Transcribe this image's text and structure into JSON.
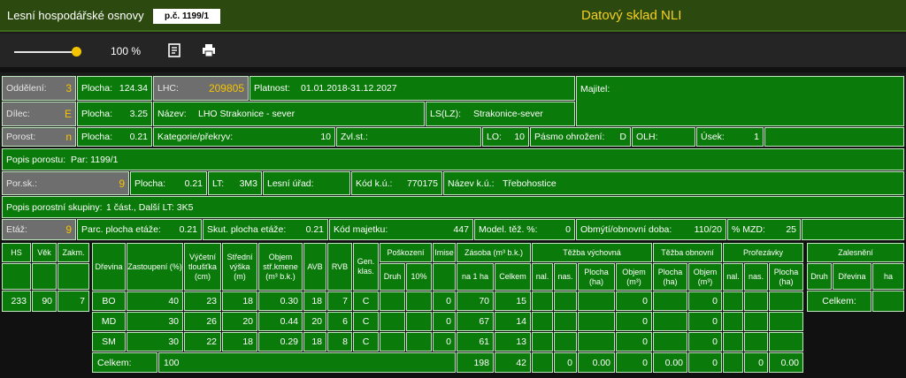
{
  "header": {
    "title": "Lesní hospodářské osnovy",
    "pc": "p.č. 1199/1",
    "datasklad": "Datový sklad NLI"
  },
  "toolbar": {
    "zoom": "100 %",
    "zoom_level": 0.9,
    "icons": [
      "notes-icon",
      "print-icon"
    ]
  },
  "row1": {
    "oddeleni_label": "Oddělení:",
    "oddeleni": "3",
    "plocha_label": "Plocha:",
    "plocha": "124.34",
    "lhc_label": "LHC:",
    "lhc": "209805",
    "platnost_label": "Platnost:",
    "platnost": "01.01.2018-31.12.2027",
    "majitel_label": "Majitel:"
  },
  "row2": {
    "dilec_label": "Dílec:",
    "dilec": "E",
    "plocha_label": "Plocha:",
    "plocha": "3.25",
    "nazev_label": "Název:",
    "nazev": "LHO Strakonice - sever",
    "ls_label": "LS(LZ):",
    "ls": "Strakonice-sever"
  },
  "row3": {
    "porost_label": "Porost:",
    "porost": "n",
    "plocha_label": "Plocha:",
    "plocha": "0.21",
    "kat_label": "Kategorie/překryv:",
    "kat": "10",
    "zvl_label": "Zvl.st.:",
    "lo_label": "LO:",
    "lo": "10",
    "pasmo_label": "Pásmo ohrožení:",
    "pasmo": "D",
    "olh_label": "OLH:",
    "usek_label": "Úsek:",
    "usek": "1"
  },
  "row4": {
    "popis_label": "Popis porostu:",
    "popis": "Par: 1199/1"
  },
  "row5": {
    "porsk_label": "Por.sk.:",
    "porsk": "9",
    "plocha_label": "Plocha:",
    "plocha": "0.21",
    "lt_label": "LT:",
    "lt": "3M3",
    "urad_label": "Lesní úřad:",
    "kodku_label": "Kód k.ú.:",
    "kodku": "770175",
    "nazevku_label": "Název k.ú.:",
    "nazevku": "Třebohostice"
  },
  "row6": {
    "popis_label": "Popis porostní skupiny:",
    "popis": "1 část., Další LT: 3K5"
  },
  "row7": {
    "etaz_label": "Etáž:",
    "etaz": "9",
    "parc_label": "Parc. plocha etáže:",
    "parc": "0.21",
    "skut_label": "Skut. plocha etáže:",
    "skut": "0.21",
    "kodmaj_label": "Kód majetku:",
    "kodmaj": "447",
    "model_label": "Model. těž. %:",
    "model": "0",
    "obmyti_label": "Obmýtí/obnovní doba:",
    "obmyti": "110/20",
    "mzd_label": "% MZD:",
    "mzd": "25"
  },
  "hs": {
    "headers": [
      "HS",
      "Věk",
      "Zakm."
    ],
    "values": [
      "233",
      "90",
      "7"
    ]
  },
  "species": {
    "headers": {
      "drevina": "Dřevina",
      "zastoupeni": "Zastoupení (%)",
      "vycetni": "Výčetní tloušťka (cm)",
      "stredni": "Střední výška (m)",
      "objem": "Objem stř.kmene (m³ b.k.)",
      "avb": "AVB",
      "rvb": "RVB",
      "gen": "Gen. klas.",
      "poskozeni": "Poškození",
      "druh": "Druh",
      "pct10": "10%",
      "imise": "Imise",
      "zasoba": "Zásoba (m³ b.k.)",
      "na1ha": "na 1 ha",
      "celkem": "Celkem",
      "tv": "Těžba výchovná",
      "tob": "Těžba obnovní",
      "proreb": "Prořezávky",
      "nal": "nal.",
      "nas": "nas.",
      "plocha_ha": "Plocha (ha)",
      "objem_m3": "Objem (m³)"
    },
    "rows": [
      {
        "d": "BO",
        "z": "40",
        "t": "23",
        "v": "18",
        "o": "0.30",
        "a": "18",
        "r": "7",
        "g": "C",
        "i": "0",
        "zh": "70",
        "zc": "15",
        "tv": "0",
        "tob": "0",
        "pp": "0"
      },
      {
        "d": "MD",
        "z": "30",
        "t": "26",
        "v": "20",
        "o": "0.44",
        "a": "20",
        "r": "6",
        "g": "C",
        "i": "0",
        "zh": "67",
        "zc": "14",
        "tv": "0",
        "tob": "0",
        "pp": "0"
      },
      {
        "d": "SM",
        "z": "30",
        "t": "22",
        "v": "18",
        "o": "0.29",
        "a": "18",
        "r": "8",
        "g": "C",
        "i": "0",
        "zh": "61",
        "zc": "13",
        "tv": "0",
        "tob": "0",
        "pp": "0"
      }
    ],
    "total": {
      "label": "Celkem:",
      "z": "100",
      "zh": "198",
      "zc": "42",
      "tv_nal": "0",
      "tv_pl": "0.00",
      "tv_obj": "0",
      "tob_pl": "0.00",
      "tob_obj": "0",
      "pr_nal": "0",
      "pr_pl": "0.00"
    }
  },
  "zalesneni": {
    "title": "Zalesnění",
    "headers": [
      "Druh",
      "Dřevina",
      "ha"
    ],
    "total_label": "Celkem:"
  }
}
